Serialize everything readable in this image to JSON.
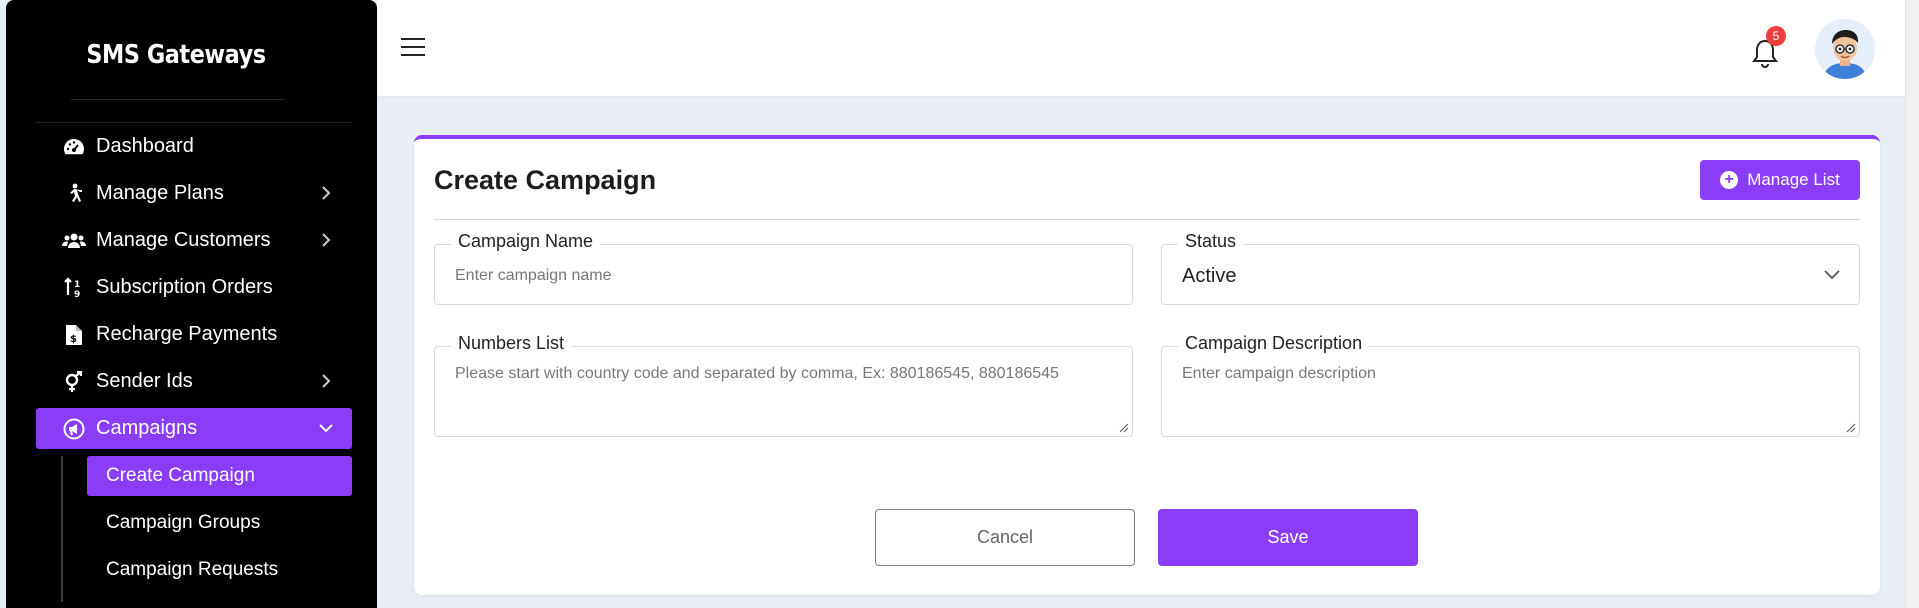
{
  "brand": "SMS Gateways",
  "sidebar": {
    "items": [
      {
        "label": "Dashboard",
        "icon": "dashboard-gauge-icon"
      },
      {
        "label": "Manage Plans",
        "icon": "walking-person-icon"
      },
      {
        "label": "Manage Customers",
        "icon": "users-group-icon"
      },
      {
        "label": "Subscription Orders",
        "icon": "sort-order-icon"
      },
      {
        "label": "Recharge Payments",
        "icon": "invoice-dollar-icon"
      },
      {
        "label": "Sender Ids",
        "icon": "gender-symbol-icon"
      },
      {
        "label": "Campaigns",
        "icon": "campaign-icon"
      }
    ],
    "submenu": [
      {
        "label": "Create Campaign"
      },
      {
        "label": "Campaign Groups"
      },
      {
        "label": "Campaign Requests"
      }
    ]
  },
  "header": {
    "notification_count": "5"
  },
  "form": {
    "title": "Create Campaign",
    "manage_list_label": "Manage List",
    "campaign_name_label": "Campaign Name",
    "campaign_name_placeholder": "Enter campaign name",
    "status_label": "Status",
    "status_value": "Active",
    "numbers_list_label": "Numbers List",
    "numbers_list_placeholder": "Please start with country code and separated by comma, Ex: 880186545, 880186545",
    "description_label": "Campaign Description",
    "description_placeholder": "Enter campaign description",
    "cancel_label": "Cancel",
    "save_label": "Save"
  },
  "colors": {
    "accent": "#8b3cf7",
    "sidebar_bg": "#000000",
    "page_bg": "#e9edf5",
    "badge": "#ef3e3e"
  }
}
